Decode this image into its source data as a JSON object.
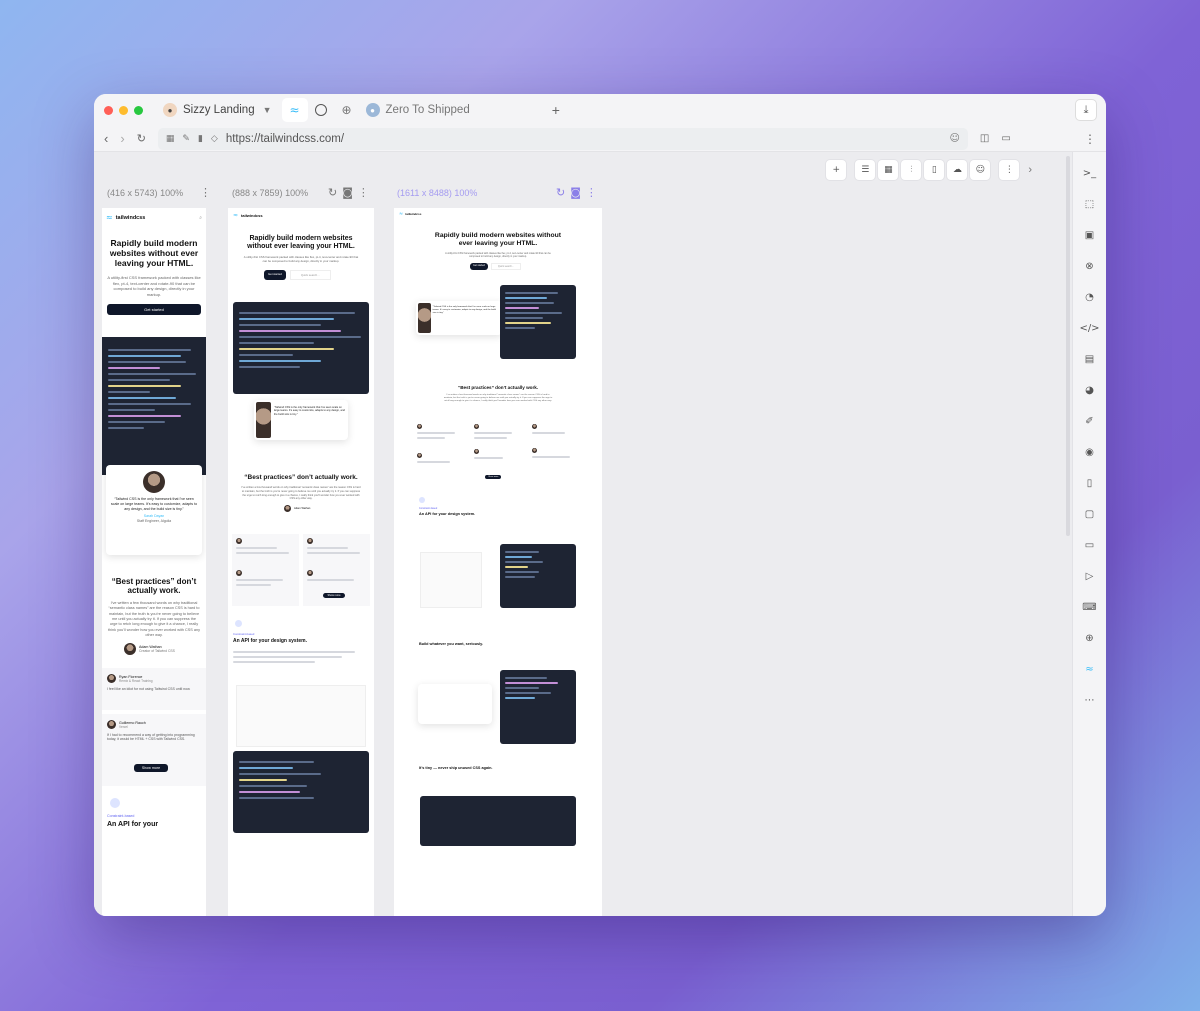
{
  "tabs": [
    {
      "label": "Sizzy Landing"
    },
    {
      "label": ""
    },
    {
      "label": ""
    },
    {
      "label": ""
    },
    {
      "label": "Zero To Shipped"
    }
  ],
  "address": {
    "url": "https://tailwindcss.com/"
  },
  "devices": [
    {
      "dims": "(416 x 5743)",
      "zoom": "100%"
    },
    {
      "dims": "(888 x 7859)",
      "zoom": "100%"
    },
    {
      "dims": "(1611 x 8488)",
      "zoom": "100%"
    }
  ],
  "site": {
    "logo": "tailwindcss",
    "hero_title": "Rapidly build modern websites without ever leaving your HTML.",
    "hero_sub": "A utility-first CSS framework packed with classes like flex, pt-4, text-center and rotate-90 that can be composed to build any design, directly in your markup.",
    "get_started": "Get started",
    "quick_search": "Quick search...",
    "testimonial": "“Tailwind CSS is the only framework that I've seen scale on large teams. It’s easy to customize, adapts to any design, and the build size is tiny.”",
    "testimonial_name": "Sarah Dayan",
    "testimonial_role": "Staff Engineer, Algolia",
    "bp_title": "“Best practices” don’t actually work.",
    "bp_text": "I’ve written a few thousand words on why traditional “semantic class names” are the reason CSS is hard to maintain, but the truth is you’re never going to believe me until you actually try it. If you can suppress the urge to retch long enough to give it a chance, I really think you’ll wonder how you ever worked with CSS any other way.",
    "author_name": "Adam Wathan",
    "author_role": "Creator of Tailwind CSS",
    "reviews": [
      {
        "name": "Ryan Florence",
        "role": "Remix & React Training",
        "text": "I feel like an idiot for not using Tailwind CSS until now."
      },
      {
        "name": "Guillermo Rauch",
        "role": "Vercel",
        "text": "If I had to recommend a way of getting into programming today, it would be HTML + CSS with Tailwind CSS."
      }
    ],
    "show_more": "Show more",
    "constraint_label": "Constraint-based",
    "api_title": "An API for your design system.",
    "api_title_partial": "An API for your",
    "build_title": "Build whatever you want, seriously.",
    "tiny_title": "It’s tiny — never ship unused CSS again."
  }
}
